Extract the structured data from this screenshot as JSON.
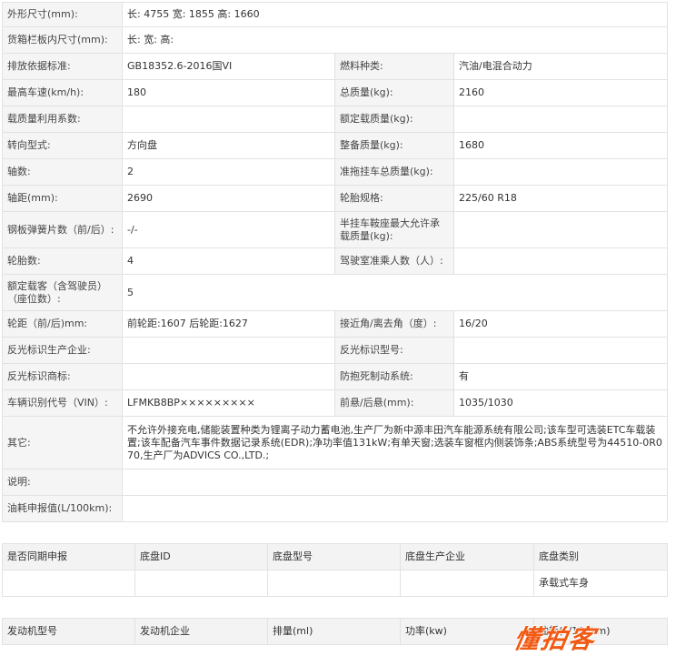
{
  "spec": {
    "rows": [
      {
        "type": "full",
        "label": "外形尺寸(mm):",
        "value": "长: 4755 宽: 1855 高: 1660",
        "h": 27
      },
      {
        "type": "full",
        "label": "货箱栏板内尺寸(mm):",
        "value": "长:  宽:  高:",
        "h": 29
      },
      {
        "type": "pair",
        "l1": "排放依据标准:",
        "v1": "GB18352.6-2016国VI",
        "l2": "燃料种类:",
        "v2": "汽油/电混合动力",
        "h": 29
      },
      {
        "type": "pair",
        "l1": "最高车速(km/h):",
        "v1": "180",
        "l2": "总质量(kg):",
        "v2": "2160",
        "h": 29
      },
      {
        "type": "pair",
        "l1": "载质量利用系数:",
        "v1": "",
        "l2": "额定载质量(kg):",
        "v2": "",
        "h": 29
      },
      {
        "type": "pair",
        "l1": "转向型式:",
        "v1": "方向盘",
        "l2": "整备质量(kg):",
        "v2": "1680",
        "h": 29
      },
      {
        "type": "pair",
        "l1": "轴数:",
        "v1": "2",
        "l2": "准拖挂车总质量(kg):",
        "v2": "",
        "h": 29
      },
      {
        "type": "pair",
        "l1": "轴距(mm):",
        "v1": "2690",
        "l2": "轮胎规格:",
        "v2": "225/60 R18",
        "h": 29
      },
      {
        "type": "pair",
        "l1": "钢板弹簧片数（前/后）:",
        "v1": "-/-",
        "l2": "半挂车鞍座最大允许承载质量(kg):",
        "v2": "",
        "h": 40
      },
      {
        "type": "pair",
        "l1": "轮胎数:",
        "v1": "4",
        "l2": "驾驶室准乘人数（人）:",
        "v2": "",
        "h": 29
      },
      {
        "type": "full",
        "label": "额定载客（含驾驶员）（座位数）:",
        "value": "5",
        "h": 40
      },
      {
        "type": "pair",
        "l1": "轮距（前/后)mm:",
        "v1": "前轮距:1607 后轮距:1627",
        "l2": "接近角/离去角（度）:",
        "v2": "16/20",
        "h": 29
      },
      {
        "type": "pair",
        "l1": "反光标识生产企业:",
        "v1": "",
        "l2": "反光标识型号:",
        "v2": "",
        "h": 29
      },
      {
        "type": "pair",
        "l1": "反光标识商标:",
        "v1": "",
        "l2": "防抱死制动系统:",
        "v2": "有",
        "h": 29
      },
      {
        "type": "pair",
        "l1": "车辆识别代号（VIN）:",
        "v1": "LFMKB8BP×××××××××",
        "l2": "前悬/后悬(mm):",
        "v2": "1035/1030",
        "h": 29
      },
      {
        "type": "full",
        "label": "其它:",
        "value": "不允许外接充电,储能装置种类为锂离子动力蓄电池,生产厂为新中源丰田汽车能源系统有限公司;该车型可选装ETC车载装置;该车配备汽车事件数据记录系统(EDR);净功率值131kW;有单天窗;选装车窗框内侧装饰条;ABS系统型号为44510-0R070,生产厂为ADVICS CO.,LTD.;",
        "h": 58
      },
      {
        "type": "full",
        "label": "说明:",
        "value": "",
        "h": 29
      },
      {
        "type": "full",
        "label": "油耗申报值(L/100km):",
        "value": "",
        "h": 29
      }
    ]
  },
  "chassis": {
    "headers": [
      "是否同期申报",
      "底盘ID",
      "底盘型号",
      "底盘生产企业",
      "底盘类别"
    ],
    "row": [
      "",
      "",
      "",
      "",
      "承载式车身"
    ]
  },
  "engine": {
    "headers": [
      "发动机型号",
      "发动机企业",
      "排量(ml)",
      "功率(kw)",
      "油耗(L/100km)"
    ]
  },
  "watermark": "懂拍客"
}
